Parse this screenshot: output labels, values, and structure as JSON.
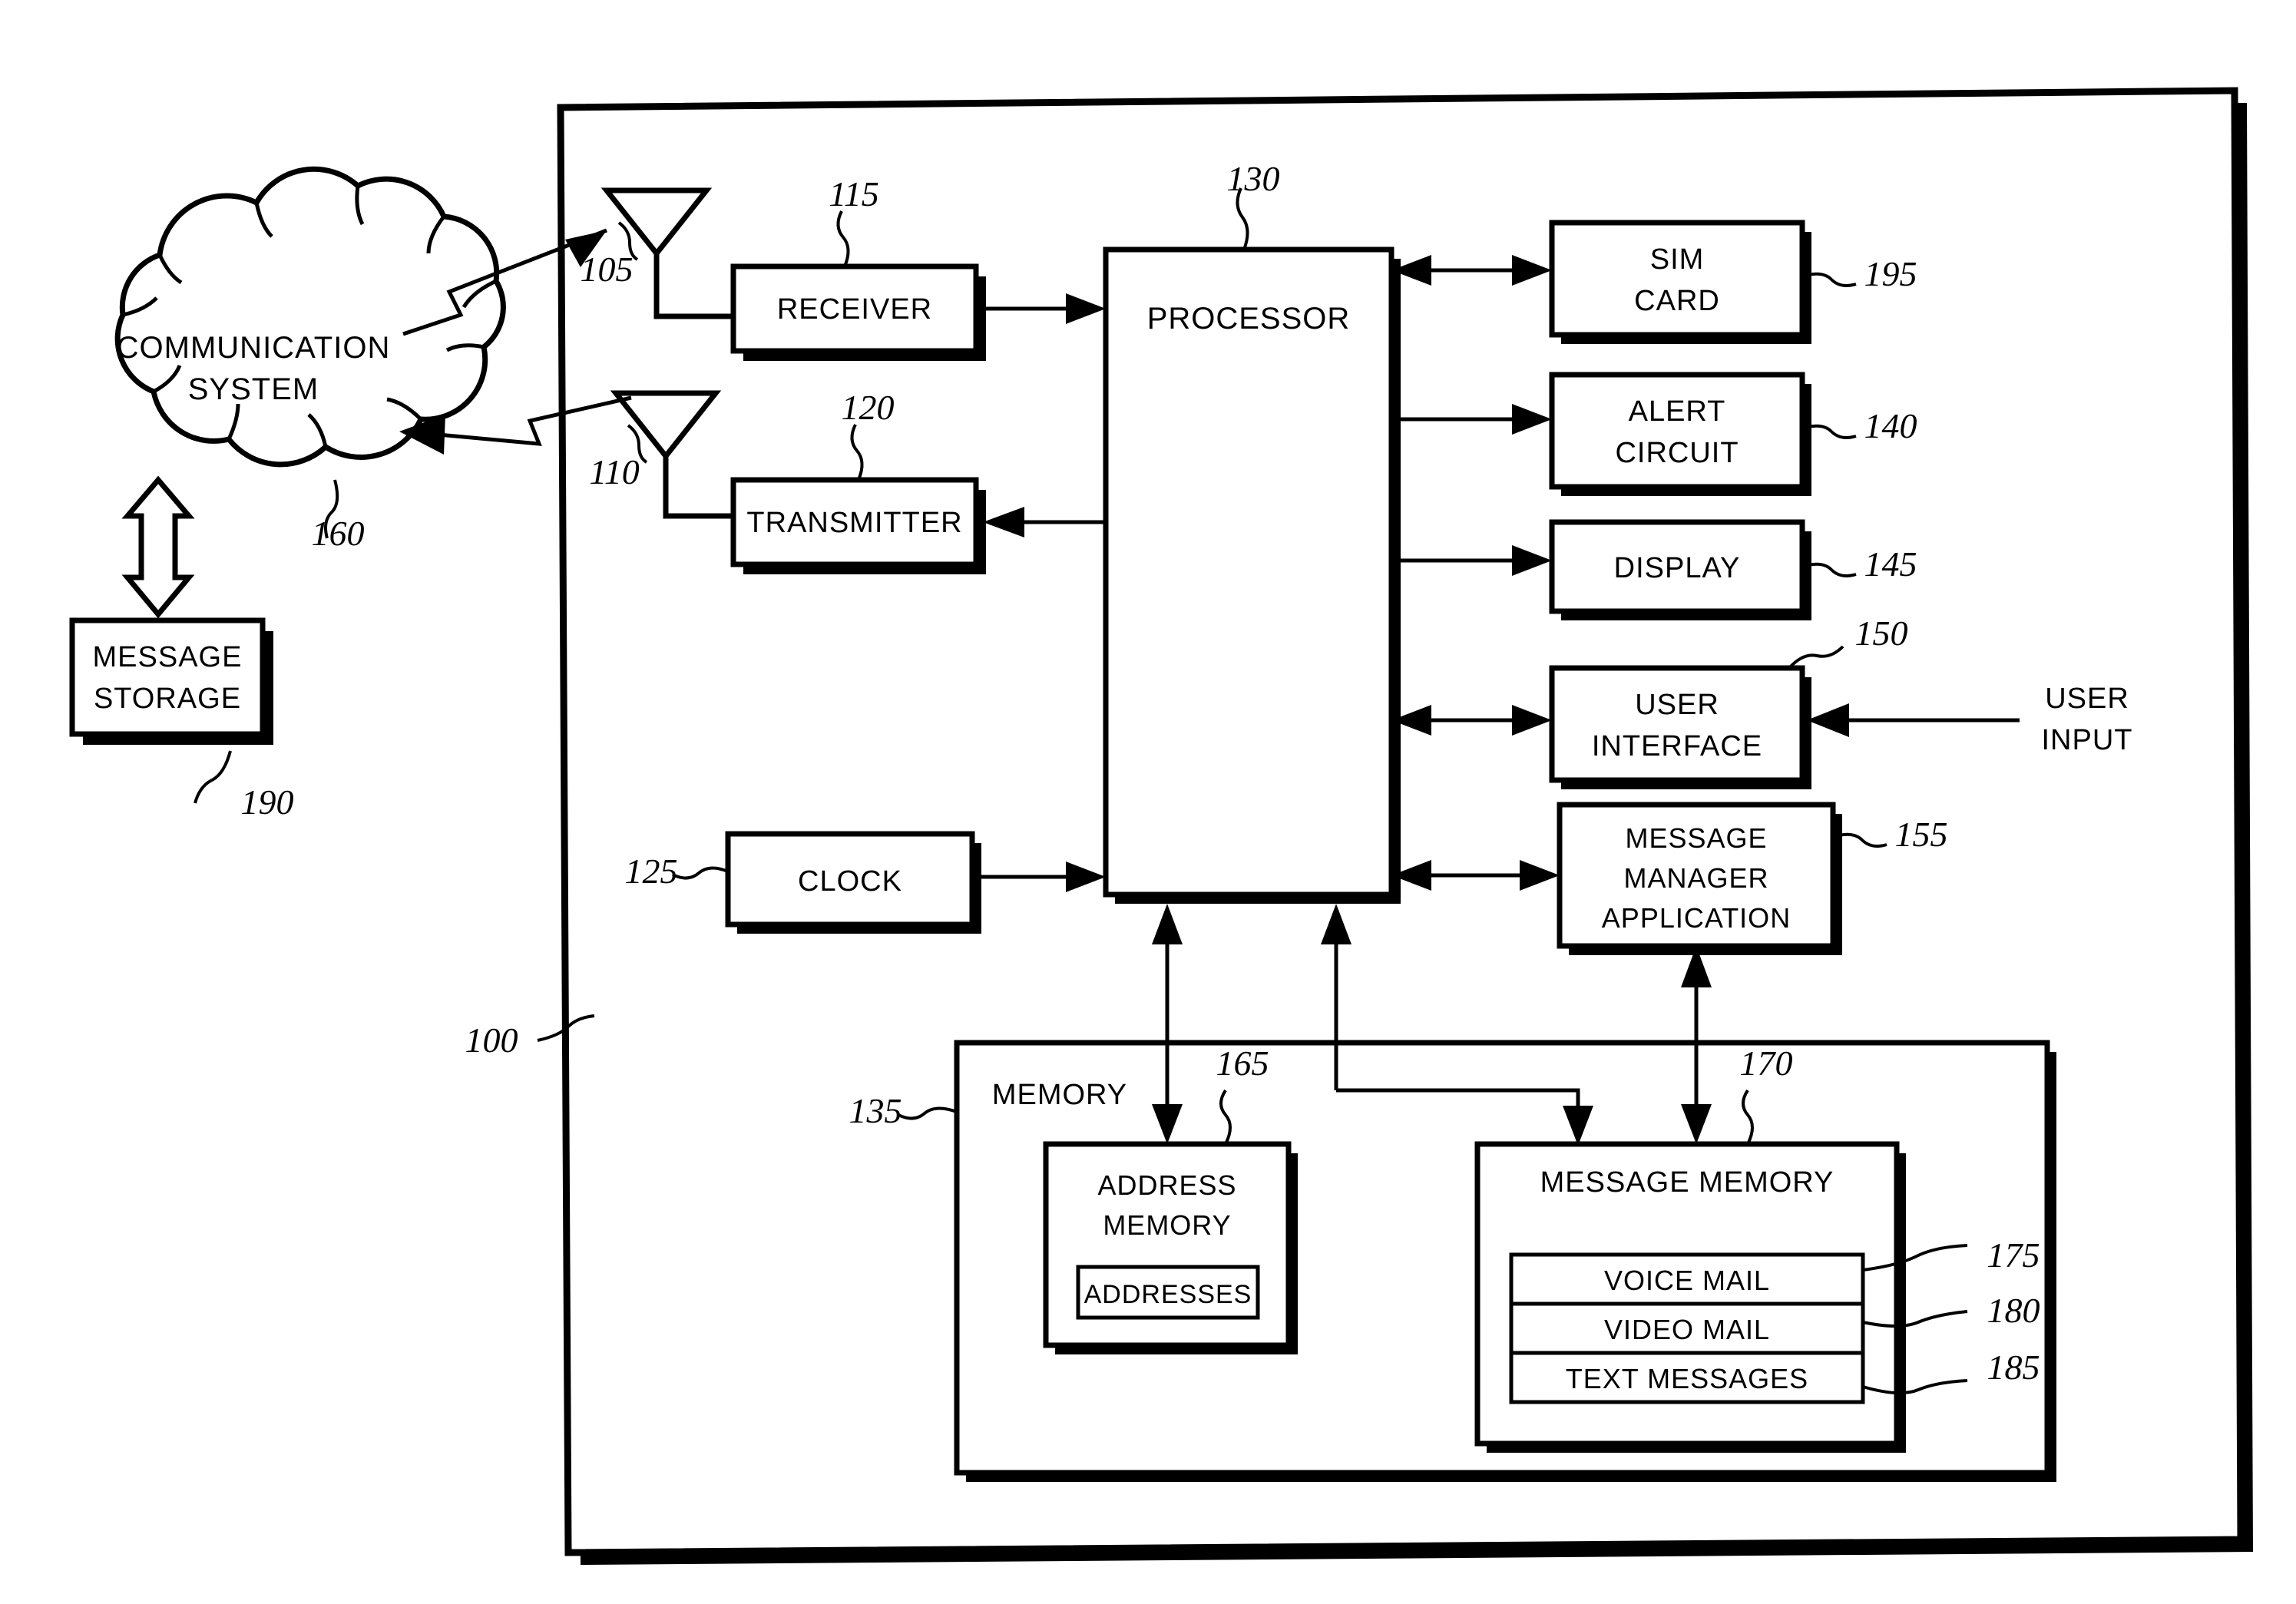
{
  "figure": {
    "kind": "patent-block-diagram",
    "title_visible": false,
    "background": "#ffffff",
    "ink": "#000000"
  },
  "external": {
    "cloud": {
      "line1": "COMMUNICATION",
      "line2": "SYSTEM",
      "ref": "160"
    },
    "message_storage": {
      "line1": "MESSAGE",
      "line2": "STORAGE",
      "ref": "190"
    },
    "user_input": {
      "line1": "USER",
      "line2": "INPUT"
    }
  },
  "device": {
    "ref": "100",
    "blocks": {
      "antenna_rx": {
        "ref": "105"
      },
      "antenna_tx": {
        "ref": "110"
      },
      "receiver": {
        "label": "RECEIVER",
        "ref": "115"
      },
      "transmitter": {
        "label": "TRANSMITTER",
        "ref": "120"
      },
      "clock": {
        "label": "CLOCK",
        "ref": "125"
      },
      "processor": {
        "label": "PROCESSOR",
        "ref": "130"
      },
      "sim_card": {
        "line1": "SIM",
        "line2": "CARD",
        "ref": "195"
      },
      "alert": {
        "line1": "ALERT",
        "line2": "CIRCUIT",
        "ref": "140"
      },
      "display": {
        "label": "DISPLAY",
        "ref": "145"
      },
      "user_interface": {
        "line1": "USER",
        "line2": "INTERFACE",
        "ref": "150"
      },
      "message_manager": {
        "line1": "MESSAGE",
        "line2": "MANAGER",
        "line3": "APPLICATION",
        "ref": "155"
      },
      "memory": {
        "label": "MEMORY",
        "ref": "135"
      },
      "address_memory": {
        "line1": "ADDRESS",
        "line2": "MEMORY",
        "ref": "165"
      },
      "addresses": {
        "label": "ADDRESSES"
      },
      "message_memory": {
        "label": "MESSAGE MEMORY",
        "ref": "170"
      },
      "voice_mail": {
        "label": "VOICE MAIL",
        "ref": "175"
      },
      "video_mail": {
        "label": "VIDEO MAIL",
        "ref": "180"
      },
      "text_messages": {
        "label": "TEXT MESSAGES",
        "ref": "185"
      }
    }
  }
}
